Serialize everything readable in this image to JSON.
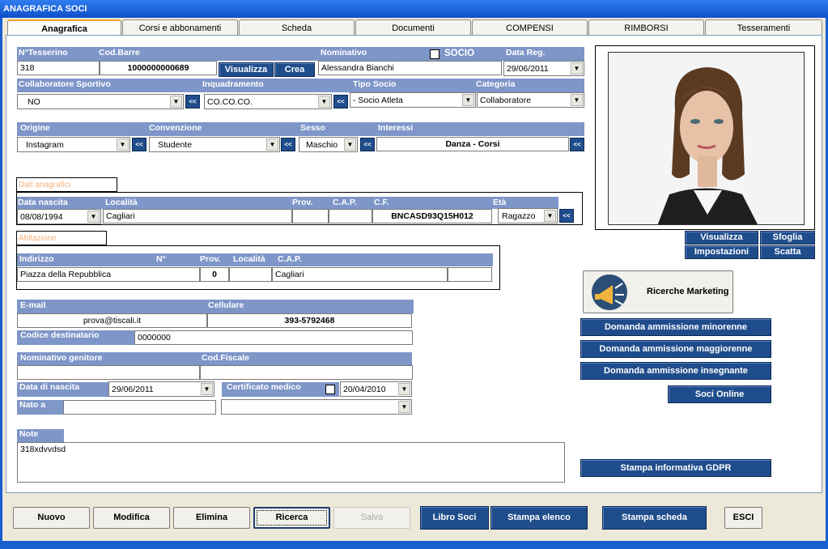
{
  "window": {
    "title": "ANAGRAFICA SOCI"
  },
  "tabs": [
    "Anagrafica",
    "Corsi e abbonamenti",
    "Scheda",
    "Documenti",
    "COMPENSI",
    "RIMBORSI",
    "Tesseramenti"
  ],
  "member": {
    "tessera_label": "N°Tesserino",
    "tessera": "318",
    "barcode_label": "Cod.Barre",
    "barcode": "1000000000689",
    "visualizza": "Visualizza",
    "crea": "Crea",
    "nominativo_label": "Nominativo",
    "nominativo": "Alessandra Bianchi",
    "socio_label": "SOCIO",
    "data_reg_label": "Data Reg.",
    "data_reg": "29/06/2011",
    "collab_label": "Collaboratore Sportivo",
    "collab": "NO",
    "inquadr_label": "Inquadramento",
    "inquadr": "CO.CO.CO.",
    "tipo_label": "Tipo Socio",
    "tipo": "- Socio Atleta",
    "categoria_label": "Categoria",
    "categoria": "Collaboratore",
    "origine_label": "Origine",
    "origine": "Instagram",
    "convenzione_label": "Convenzione",
    "convenzione": "Studente",
    "sesso_label": "Sesso",
    "sesso": "Maschio",
    "interessi_label": "Interessi",
    "interessi": "Danza - Corsi",
    "shift_symbol": "<<"
  },
  "anagrafici": {
    "section": "Dati anagrafici",
    "nascita_label": "Data nascita",
    "nascita": "08/08/1994",
    "localita_label": "Località",
    "localita": "Cagliari",
    "prov_label": "Prov.",
    "prov": "",
    "cap_label": "C.A.P.",
    "cap": "",
    "cf_label": "C.F.",
    "cf": "BNCASD93Q15H012",
    "eta_label": "Età",
    "eta": "Ragazzo"
  },
  "abitazione": {
    "section": "Abitazione",
    "indirizzo_label": "Indirizzo",
    "indirizzo": "Piazza della Repubblica",
    "num_label": "N°",
    "num": "0",
    "prov_label": "Prov.",
    "prov": "",
    "localita_label": "Località",
    "localita": "",
    "cap_label": "C.A.P.",
    "cap": "Cagliari"
  },
  "contatti": {
    "email_label": "E-mail",
    "email": "prova@tiscali.it",
    "cell_label": "Cellulare",
    "cell": "393-5792468",
    "coddest_label": "Codice destinatario",
    "coddest": "0000000",
    "genitore_label": "Nominativo genitore",
    "genitore": "",
    "codfisc_label": "Cod.Fiscale",
    "codfisc": "",
    "datanasc_label": "Data di nascita",
    "datanasc": "29/06/2011",
    "cert_label": "Certificato medico",
    "cert_date": "20/04/2010",
    "nato_label": "Nato a",
    "nato": ""
  },
  "note": {
    "label": "Note",
    "text": "318xdvvdsd"
  },
  "photo": {
    "btn_visualizza": "Visualizza",
    "btn_sfoglia": "Sfoglia",
    "btn_impostazioni": "Impostazioni",
    "btn_scatta": "Scatta"
  },
  "right": {
    "marketing": "Ricerche Marketing",
    "dom_min": "Domanda ammissione minorenne",
    "dom_mag": "Domanda ammissione maggiorenne",
    "dom_ins": "Domanda ammissione insegnante",
    "soci_online": "Soci Online",
    "gdpr": "Stampa informativa GDPR"
  },
  "bottom": {
    "nuovo": "Nuovo",
    "modifica": "Modifica",
    "elimina": "Elimina",
    "ricerca": "Ricerca",
    "salva": "Salva",
    "libro": "Libro Soci",
    "elenco": "Stampa elenco",
    "scheda": "Stampa scheda",
    "esci": "ESCI"
  },
  "colors": {
    "header_blue": "#7e96c8",
    "button_blue": "#1f4d8c",
    "title_blue": "#0f4fc9"
  }
}
